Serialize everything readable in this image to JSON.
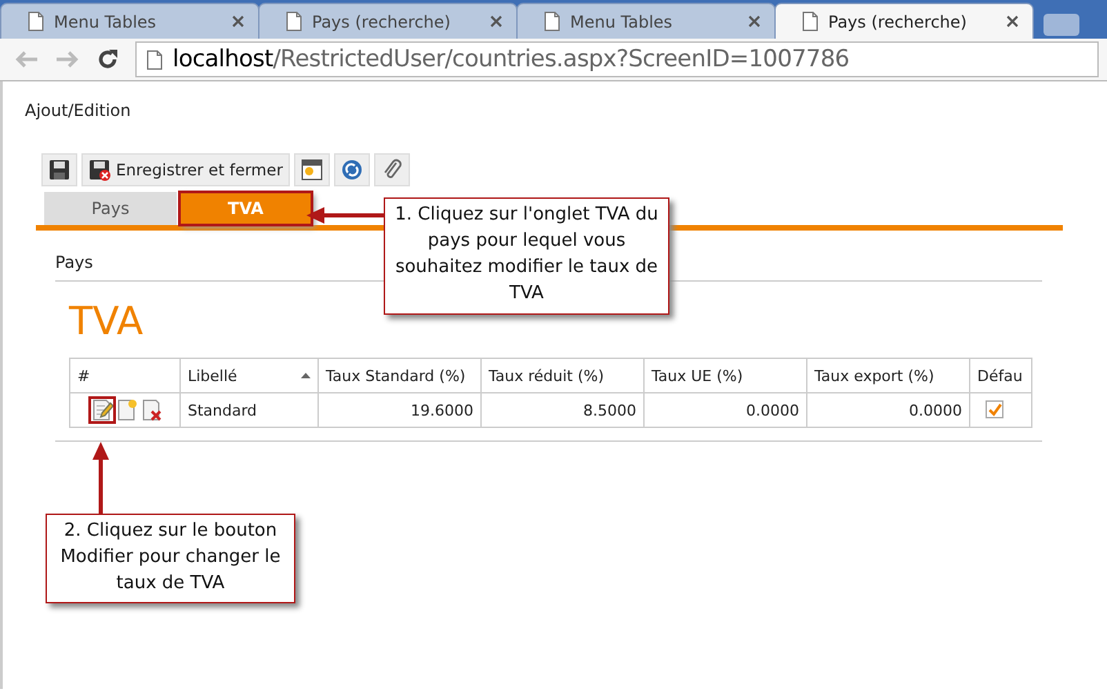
{
  "browser_tabs": [
    {
      "title": "Menu Tables",
      "selected": false
    },
    {
      "title": "Pays (recherche)",
      "selected": false
    },
    {
      "title": "Menu Tables",
      "selected": false
    },
    {
      "title": "Pays (recherche)",
      "selected": true
    }
  ],
  "address_bar": {
    "host": "localhost",
    "path": "/RestrictedUser/countries.aspx?ScreenID=1007786"
  },
  "page_title": "Ajout/Edition",
  "toolbar": [
    {
      "kind": "save"
    },
    {
      "kind": "save-close",
      "label": "Enregistrer et fermer"
    },
    {
      "kind": "new-window"
    },
    {
      "kind": "refresh"
    },
    {
      "kind": "attach"
    }
  ],
  "tabs": [
    {
      "label": "Pays",
      "selected": false
    },
    {
      "label": "TVA",
      "selected": true
    }
  ],
  "section_label": "Pays",
  "heading": "TVA",
  "table": {
    "columns": [
      "#",
      "Libellé",
      "Taux Standard (%)",
      "Taux réduit (%)",
      "Taux UE (%)",
      "Taux export (%)",
      "Défau"
    ],
    "rows": [
      {
        "cells": [
          "",
          "Standard",
          "19.6000",
          "8.5000",
          "0.0000",
          "0.0000"
        ],
        "default": true
      }
    ]
  },
  "annotations": [
    {
      "text": "1. Cliquez sur l'onglet TVA du pays pour lequel vous souhaitez modifier le taux de TVA"
    },
    {
      "text": "2. Cliquez sur le bouton Modifier pour changer le taux de TVA"
    }
  ]
}
